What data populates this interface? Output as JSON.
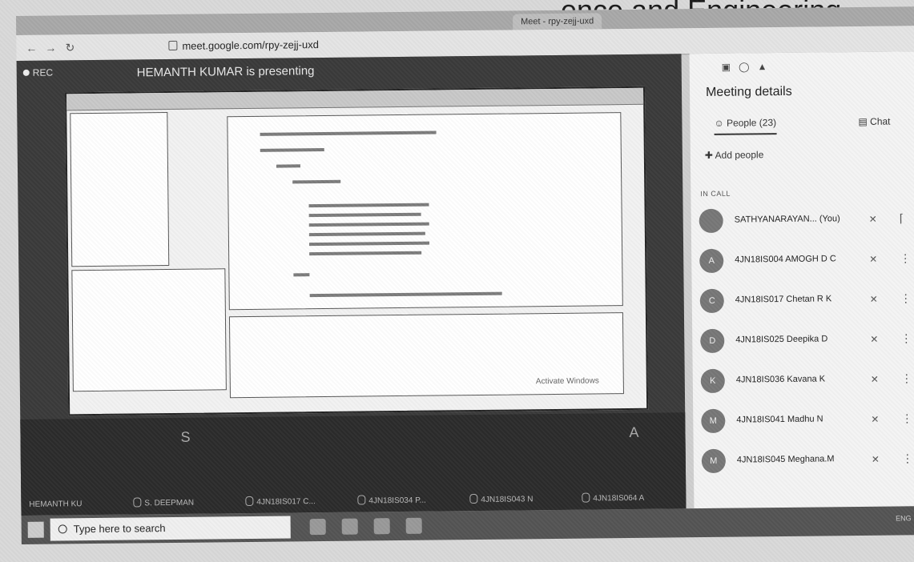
{
  "page_heading": "ence and Engineering",
  "browser": {
    "tabs": [
      "Meet - rpy-zejj-uxd"
    ],
    "url": "meet.google.com/rpy-zejj-uxd"
  },
  "meet": {
    "rec_label": "REC",
    "presenting_text": "HEMANTH KUMAR is presenting",
    "activate_windows": "Activate Windows",
    "participant_tiles": [
      {
        "name": "HEMANTH KU",
        "letter": ""
      },
      {
        "name": "S. DEEPMAN",
        "letter": "S"
      },
      {
        "name": "4JN18IS017 C...",
        "letter": ""
      },
      {
        "name": "4JN18IS034 P...",
        "letter": ""
      },
      {
        "name": "4JN18IS043 N",
        "letter": ""
      },
      {
        "name": "4JN18IS064 A",
        "letter": "A"
      }
    ]
  },
  "panel": {
    "title": "Meeting details",
    "people_tab": "People (23)",
    "chat_tab": "Chat",
    "add_people": "Add people",
    "in_call": "IN CALL",
    "participants": [
      {
        "avatar": "",
        "name": "SATHYANARAYAN... (You)"
      },
      {
        "avatar": "A",
        "name": "4JN18IS004 AMOGH D C"
      },
      {
        "avatar": "C",
        "name": "4JN18IS017 Chetan R K"
      },
      {
        "avatar": "D",
        "name": "4JN18IS025 Deepika D"
      },
      {
        "avatar": "K",
        "name": "4JN18IS036 Kavana K"
      },
      {
        "avatar": "M",
        "name": "4JN18IS041 Madhu N"
      },
      {
        "avatar": "M",
        "name": "4JN18IS045 Meghana.M"
      }
    ]
  },
  "taskbar": {
    "search_placeholder": "Type here to search",
    "tray_lang": "ENG"
  }
}
